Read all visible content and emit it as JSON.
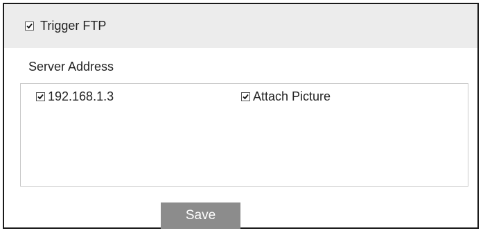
{
  "trigger": {
    "label": "Trigger FTP",
    "checked": true
  },
  "server": {
    "label": "Server Address",
    "entries": [
      {
        "address": "192.168.1.3",
        "checked": true
      },
      {
        "attach_label": "Attach Picture",
        "checked": true
      }
    ]
  },
  "actions": {
    "save_label": "Save"
  },
  "colors": {
    "header_bg": "#ececec",
    "button_bg": "#8c8c8c",
    "button_text": "#ffffff",
    "border": "#1a1a1a"
  }
}
